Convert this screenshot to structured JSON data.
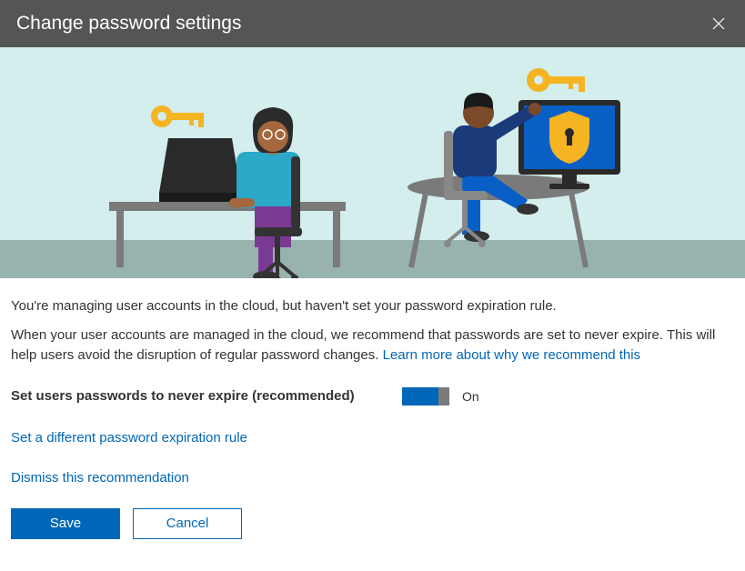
{
  "header": {
    "title": "Change password settings"
  },
  "body": {
    "para1": "You're managing user accounts in the cloud, but haven't set your password expiration rule.",
    "para2_a": "When your user accounts are managed in the cloud, we recommend that passwords are set to never expire. This will help users avoid the disruption of regular password changes. ",
    "learn_more": "Learn more about why we recommend this"
  },
  "setting": {
    "label": "Set users passwords to never expire (recommended)",
    "toggle_state": "On"
  },
  "links": {
    "different_rule": "Set a different password expiration rule",
    "dismiss": "Dismiss this recommendation"
  },
  "buttons": {
    "save": "Save",
    "cancel": "Cancel"
  }
}
